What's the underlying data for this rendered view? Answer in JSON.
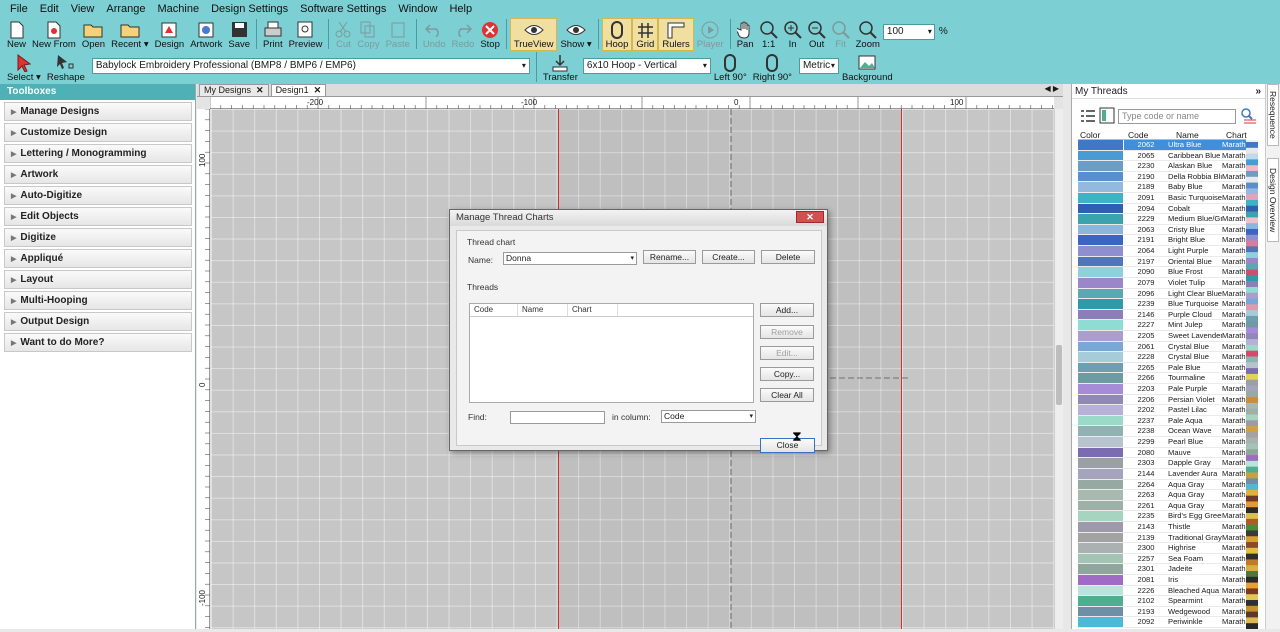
{
  "menu": [
    "File",
    "Edit",
    "View",
    "Arrange",
    "Machine",
    "Design Settings",
    "Software Settings",
    "Window",
    "Help"
  ],
  "toolbar": {
    "new": "New",
    "new_from": "New From",
    "open": "Open",
    "recent": "Recent",
    "design": "Design",
    "artwork": "Artwork",
    "save": "Save",
    "print": "Print",
    "preview": "Preview",
    "cut": "Cut",
    "copy": "Copy",
    "paste": "Paste",
    "undo": "Undo",
    "redo": "Redo",
    "stop": "Stop",
    "trueview": "TrueView",
    "show": "Show",
    "hoop": "Hoop",
    "grid": "Grid",
    "rulers": "Rulers",
    "player": "Player",
    "pan": "Pan",
    "one_to_one": "1:1",
    "zoom_in": "In",
    "zoom_out": "Out",
    "fit": "Fit",
    "zoom": "Zoom",
    "zoom_value": "100",
    "zoom_unit": "%"
  },
  "toolbar2": {
    "select": "Select",
    "reshape": "Reshape",
    "machine_format": "Babylock Embroidery Professional (BMP8 / BMP6 / EMP6)",
    "transfer": "Transfer",
    "hoop": "6x10 Hoop - Vertical",
    "left90": "Left 90°",
    "right90": "Right 90°",
    "units": "Metric",
    "background": "Background"
  },
  "toolboxes": {
    "title": "Toolboxes",
    "items": [
      "Manage Designs",
      "Customize Design",
      "Lettering / Monogramming",
      "Artwork",
      "Auto-Digitize",
      "Edit Objects",
      "Digitize",
      "Appliqué",
      "Layout",
      "Multi-Hooping",
      "Output Design",
      "Want to do More?"
    ]
  },
  "tabs": [
    "My Designs",
    "Design1"
  ],
  "ruler": {
    "h": [
      "-200",
      "-100",
      "0",
      "100"
    ],
    "v": [
      "100",
      "0",
      "-100"
    ]
  },
  "dialog": {
    "title": "Manage Thread Charts",
    "thread_chart_label": "Thread chart",
    "name_label": "Name:",
    "name_value": "Donna",
    "rename": "Rename...",
    "create": "Create...",
    "delete": "Delete",
    "threads_label": "Threads",
    "columns": [
      "Code",
      "Name",
      "Chart"
    ],
    "add": "Add...",
    "remove": "Remove",
    "edit": "Edit...",
    "copy": "Copy...",
    "clear_all": "Clear All",
    "find_label": "Find:",
    "find_value": "",
    "in_column_label": "in column:",
    "in_column_value": "Code",
    "close": "Close"
  },
  "threads": {
    "title": "My Threads",
    "search_placeholder": "Type code or name",
    "columns": [
      "Color",
      "Code",
      "Name",
      "Chart"
    ],
    "rows": [
      {
        "code": "2062",
        "name": "Ultra Blue",
        "chart": "Marathon",
        "color": "#3f78c4",
        "selected": true
      },
      {
        "code": "2065",
        "name": "Caribbean Blue",
        "chart": "Marathon",
        "color": "#4a9ad4"
      },
      {
        "code": "2230",
        "name": "Alaskan Blue",
        "chart": "Marathon",
        "color": "#6b9ec6"
      },
      {
        "code": "2190",
        "name": "Della Robbia Blue",
        "chart": "Marathon",
        "color": "#5a8fcf"
      },
      {
        "code": "2189",
        "name": "Baby Blue",
        "chart": "Marathon",
        "color": "#93b9de"
      },
      {
        "code": "2091",
        "name": "Basic Turquoise",
        "chart": "Marathon",
        "color": "#3fb2c6"
      },
      {
        "code": "2094",
        "name": "Cobalt",
        "chart": "Marathon",
        "color": "#2f5fb1"
      },
      {
        "code": "2229",
        "name": "Medium Blue/Green",
        "chart": "Marathon",
        "color": "#3aa3ad"
      },
      {
        "code": "2063",
        "name": "Cristy Blue",
        "chart": "Marathon",
        "color": "#8cb7dd"
      },
      {
        "code": "2191",
        "name": "Bright Blue",
        "chart": "Marathon",
        "color": "#3c64c3"
      },
      {
        "code": "2064",
        "name": "Light Purple",
        "chart": "Marathon",
        "color": "#8f8fcf"
      },
      {
        "code": "2197",
        "name": "Oriental Blue",
        "chart": "Marathon",
        "color": "#4e76b8"
      },
      {
        "code": "2090",
        "name": "Blue Frost",
        "chart": "Marathon",
        "color": "#8fd0dc"
      },
      {
        "code": "2079",
        "name": "Violet Tulip",
        "chart": "Marathon",
        "color": "#9b86c9"
      },
      {
        "code": "2096",
        "name": "Light Clear Blue",
        "chart": "Marathon",
        "color": "#5ba8b3"
      },
      {
        "code": "2239",
        "name": "Blue Turquoise",
        "chart": "Marathon",
        "color": "#2f9aa8"
      },
      {
        "code": "2146",
        "name": "Purple Cloud",
        "chart": "Marathon",
        "color": "#8d7db8"
      },
      {
        "code": "2227",
        "name": "Mint Julep",
        "chart": "Marathon",
        "color": "#8fdcd4"
      },
      {
        "code": "2205",
        "name": "Sweet Lavender",
        "chart": "Marathon",
        "color": "#a99fcf"
      },
      {
        "code": "2061",
        "name": "Crystal Blue",
        "chart": "Marathon",
        "color": "#79a8d8"
      },
      {
        "code": "2228",
        "name": "Crystal Blue",
        "chart": "Marathon",
        "color": "#a6cbd9"
      },
      {
        "code": "2265",
        "name": "Pale Blue",
        "chart": "Marathon",
        "color": "#6d9fb1"
      },
      {
        "code": "2266",
        "name": "Tourmaline",
        "chart": "Marathon",
        "color": "#6e9aa1"
      },
      {
        "code": "2203",
        "name": "Pale Purple",
        "chart": "Marathon",
        "color": "#a68bd8"
      },
      {
        "code": "2206",
        "name": "Persian Violet",
        "chart": "Marathon",
        "color": "#8f88b9"
      },
      {
        "code": "2202",
        "name": "Pastel Lilac",
        "chart": "Marathon",
        "color": "#b7b0d9"
      },
      {
        "code": "2237",
        "name": "Pale Aqua",
        "chart": "Marathon",
        "color": "#9bd9c9"
      },
      {
        "code": "2238",
        "name": "Ocean Wave",
        "chart": "Marathon",
        "color": "#8fb3b3"
      },
      {
        "code": "2299",
        "name": "Pearl Blue",
        "chart": "Marathon",
        "color": "#b7c4cf"
      },
      {
        "code": "2080",
        "name": "Mauve",
        "chart": "Marathon",
        "color": "#7b6bb0"
      },
      {
        "code": "2303",
        "name": "Dapple Gray",
        "chart": "Marathon",
        "color": "#9aa0a6"
      },
      {
        "code": "2144",
        "name": "Lavender Aura",
        "chart": "Marathon",
        "color": "#a4a4bd"
      },
      {
        "code": "2264",
        "name": "Aqua Gray",
        "chart": "Marathon",
        "color": "#97a9a3"
      },
      {
        "code": "2263",
        "name": "Aqua Gray",
        "chart": "Marathon",
        "color": "#a7b9b1"
      },
      {
        "code": "2261",
        "name": "Aqua Gray",
        "chart": "Marathon",
        "color": "#9fb0a8"
      },
      {
        "code": "2235",
        "name": "Bird's Egg Green",
        "chart": "Marathon",
        "color": "#a5d4c1"
      },
      {
        "code": "2143",
        "name": "Thistle",
        "chart": "Marathon",
        "color": "#9f9aab"
      },
      {
        "code": "2139",
        "name": "Traditional Gray",
        "chart": "Marathon",
        "color": "#a2a2a2"
      },
      {
        "code": "2300",
        "name": "Highrise",
        "chart": "Marathon",
        "color": "#a9b2b0"
      },
      {
        "code": "2257",
        "name": "Sea Foam",
        "chart": "Marathon",
        "color": "#a3c4b4"
      },
      {
        "code": "2301",
        "name": "Jadeite",
        "chart": "Marathon",
        "color": "#8fa69b"
      },
      {
        "code": "2081",
        "name": "Iris",
        "chart": "Marathon",
        "color": "#a06bc4"
      },
      {
        "code": "2226",
        "name": "Bleached Aqua",
        "chart": "Marathon",
        "color": "#b9e3dd"
      },
      {
        "code": "2102",
        "name": "Spearmint",
        "chart": "Marathon",
        "color": "#4fae8f"
      },
      {
        "code": "2193",
        "name": "Wedgewood",
        "chart": "Marathon",
        "color": "#6f8fa6"
      },
      {
        "code": "2092",
        "name": "Periwinkle",
        "chart": "Marathon",
        "color": "#4fb8d6"
      }
    ]
  },
  "side_tabs": [
    "Resequence",
    "Design Overview"
  ],
  "swatch_colors": [
    "#3f78c4",
    "#e8e8e8",
    "#c0d9ec",
    "#4a9ad4",
    "#f2b9c4",
    "#6b9ec6",
    "#e8e8e8",
    "#5a8fcf",
    "#93b9de",
    "#e8a2b6",
    "#3fb2c6",
    "#2f5fb1",
    "#3aa3ad",
    "#f0c0cc",
    "#8cb7dd",
    "#3c64c3",
    "#8f8fcf",
    "#d97b9b",
    "#4e76b8",
    "#8fd0dc",
    "#9b86c9",
    "#5ba8b3",
    "#c9516f",
    "#2f9aa8",
    "#8d7db8",
    "#8fdcd4",
    "#a99fcf",
    "#79a8d8",
    "#e895ad",
    "#a6cbd9",
    "#6d9fb1",
    "#6e9aa1",
    "#a68bd8",
    "#8f88b9",
    "#b7b0d9",
    "#9bd9c9",
    "#d54a6a",
    "#8fb3b3",
    "#b7c4cf",
    "#7b6bb0",
    "#e2d15a",
    "#9aa0a6",
    "#a4a4bd",
    "#97a9a3",
    "#cf8a3a",
    "#a7b9b1",
    "#9fb0a8",
    "#a5d4c1",
    "#9f9aab",
    "#d1a140",
    "#a2a2a2",
    "#a9b2b0",
    "#a3c4b4",
    "#8fa69b",
    "#a06bc4",
    "#b9e3dd",
    "#4fae8f",
    "#c8a23a",
    "#6f8fa6",
    "#4fb8d6",
    "#e0b040",
    "#6b3a2a",
    "#e89a30",
    "#2a2a2a",
    "#d9c14f",
    "#b05a2a",
    "#4a8c3a",
    "#3a3a3a",
    "#d9a030",
    "#8a4a2a",
    "#e0c040",
    "#2f2f2f",
    "#c07a2a",
    "#d9b040",
    "#4a7a3a",
    "#2a2a2a",
    "#e8a030",
    "#7a3a1a",
    "#e0c858",
    "#303030",
    "#c8902a",
    "#5a3a2a",
    "#e0b850",
    "#282828"
  ]
}
